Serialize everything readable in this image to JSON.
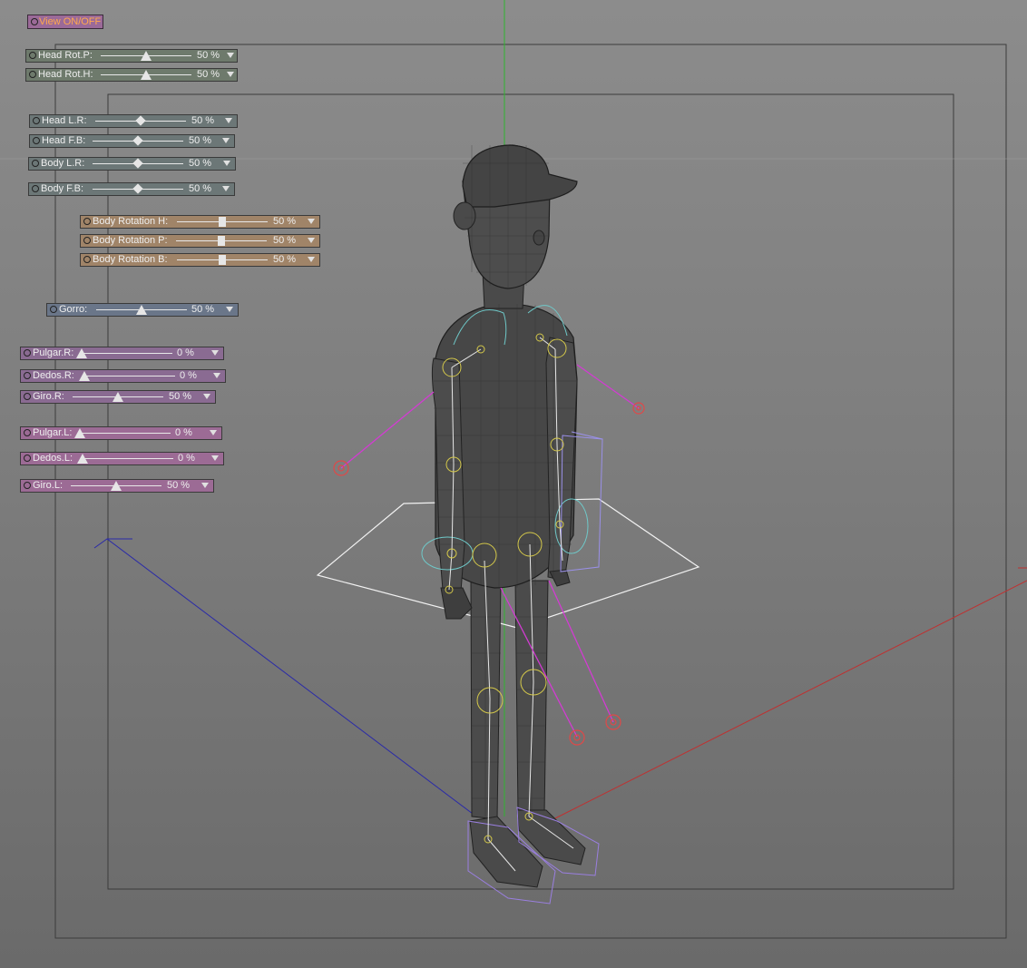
{
  "view_toggle": {
    "label": "View ON/OFF"
  },
  "controls": [
    {
      "id": "head-rot-p",
      "label": "Head Rot.P:",
      "value": "50 %",
      "fraction": 0.5
    },
    {
      "id": "head-rot-h",
      "label": "Head Rot.H:",
      "value": "50 %",
      "fraction": 0.5
    },
    {
      "id": "head-lr",
      "label": "Head L.R:",
      "value": "50 %",
      "fraction": 0.5
    },
    {
      "id": "head-fb",
      "label": "Head F.B:",
      "value": "50 %",
      "fraction": 0.5
    },
    {
      "id": "body-lr",
      "label": "Body L.R:",
      "value": "50 %",
      "fraction": 0.5
    },
    {
      "id": "body-fb",
      "label": "Body F.B:",
      "value": "50 %",
      "fraction": 0.5
    },
    {
      "id": "body-rotation-h",
      "label": "Body Rotation H:",
      "value": "50 %",
      "fraction": 0.5
    },
    {
      "id": "body-rotation-p",
      "label": "Body Rotation P:",
      "value": "50 %",
      "fraction": 0.5
    },
    {
      "id": "body-rotation-b",
      "label": "Body Rotation B:",
      "value": "50 %",
      "fraction": 0.5
    },
    {
      "id": "gorro",
      "label": "Gorro:",
      "value": "50 %",
      "fraction": 0.5
    },
    {
      "id": "pulgar-r",
      "label": "Pulgar.R:",
      "value": "0 %",
      "fraction": 0
    },
    {
      "id": "dedos-r",
      "label": "Dedos.R:",
      "value": "0 %",
      "fraction": 0
    },
    {
      "id": "giro-r",
      "label": "Giro.R:",
      "value": "50 %",
      "fraction": 0.5
    },
    {
      "id": "pulgar-l",
      "label": "Pulgar.L:",
      "value": "0 %",
      "fraction": 0
    },
    {
      "id": "dedos-l",
      "label": "Dedos.L:",
      "value": "0 %",
      "fraction": 0
    },
    {
      "id": "giro-l",
      "label": "Giro.L:",
      "value": "50 %",
      "fraction": 0.5
    }
  ],
  "colors": {
    "view_toggle_text": "#ffa94d",
    "y_axis": "#2fb52f",
    "x_axis": "#c03030",
    "z_axis": "#2a2aa8",
    "ik_handle": "#d33bd3",
    "ik_target": "#e04848",
    "joint": "#d4c84a",
    "rotation_gizmo": "#6fc9c9"
  }
}
